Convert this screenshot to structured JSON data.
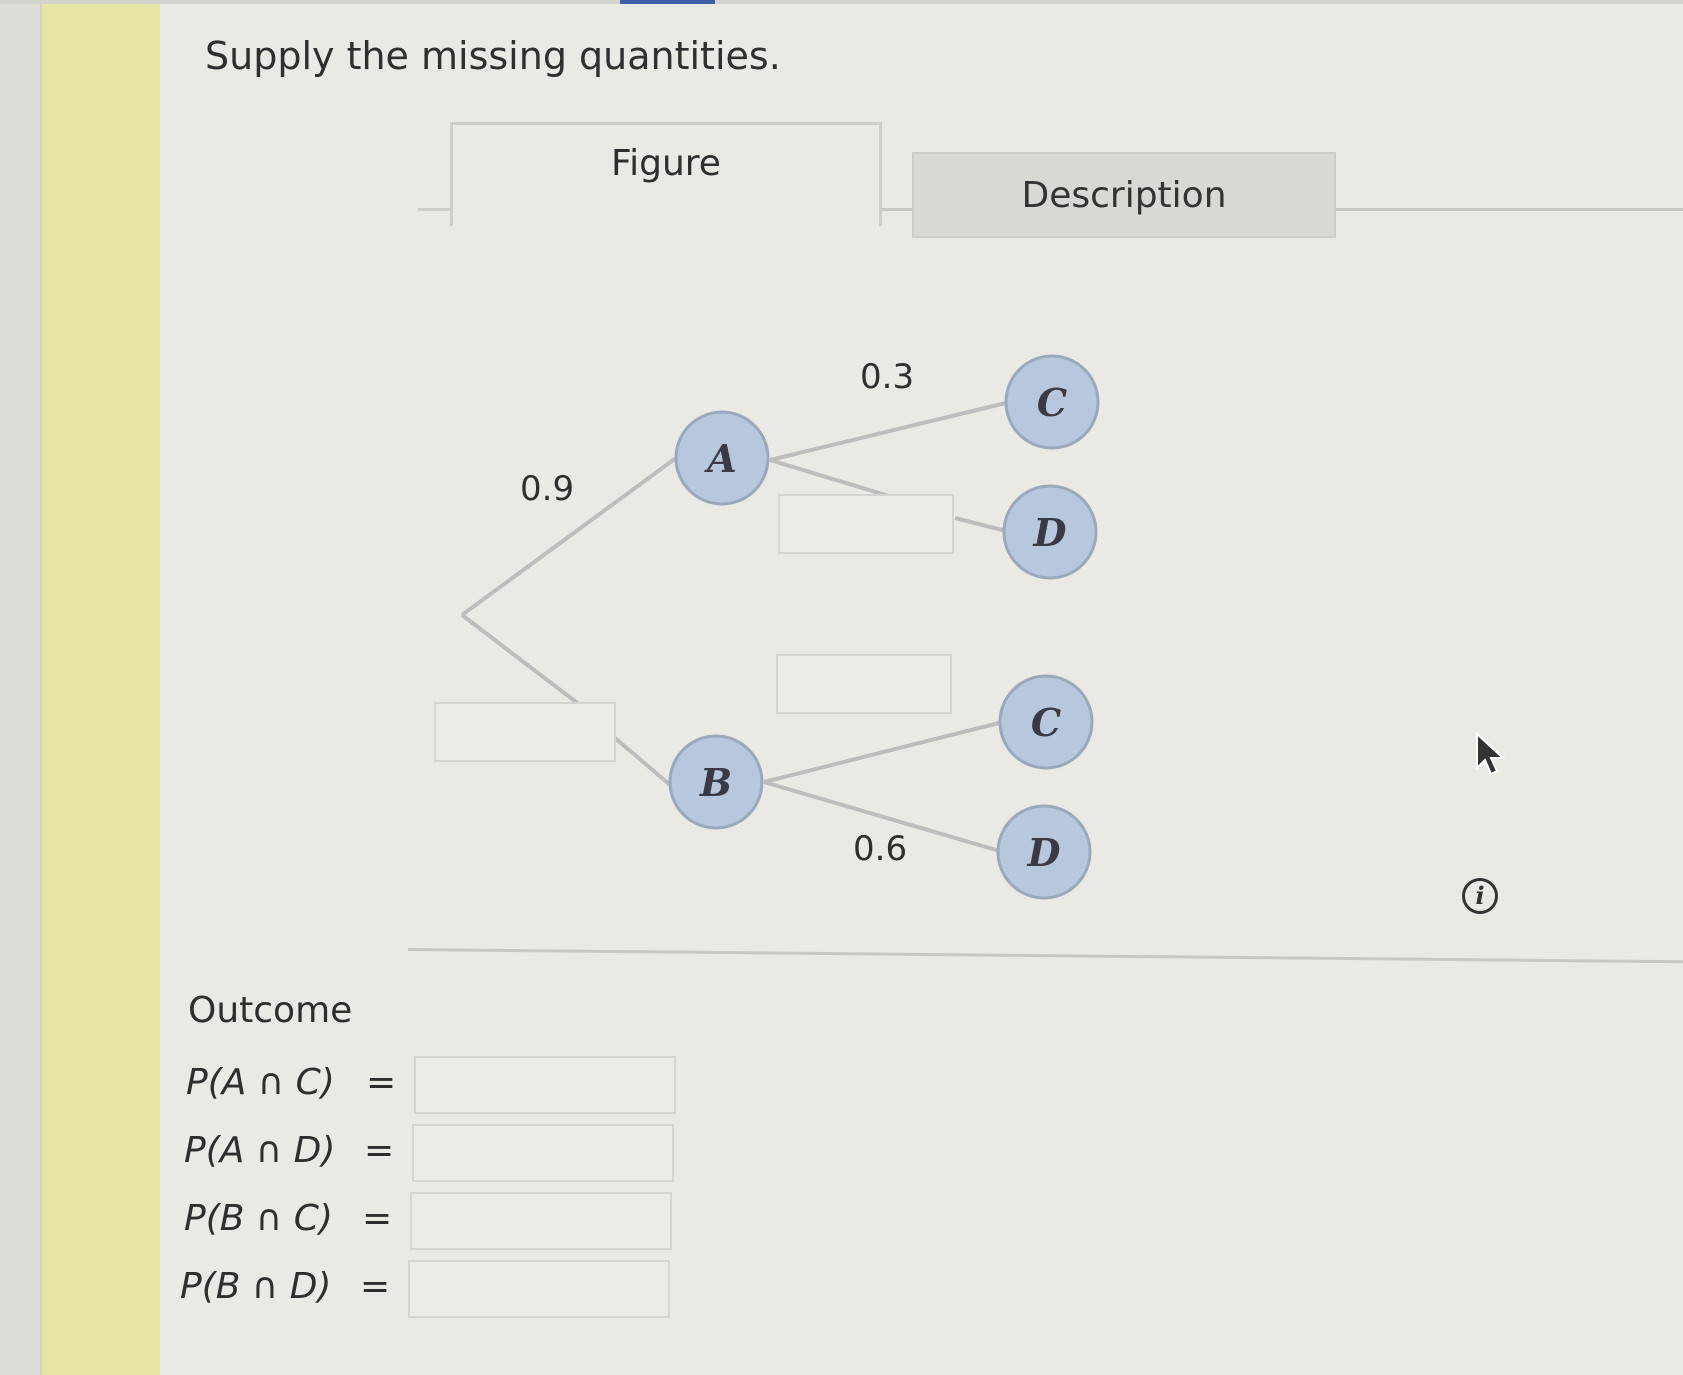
{
  "instructions": "Supply the missing quantities.",
  "tabs": {
    "figure": "Figure",
    "description": "Description"
  },
  "tree": {
    "nodes": {
      "A": "A",
      "B": "B",
      "AC": "C",
      "AD": "D",
      "BC": "C",
      "BD": "D"
    },
    "probabilities": {
      "root_to_A": "0.9",
      "root_to_B": "",
      "A_to_C": "0.3",
      "A_to_D": "",
      "B_to_C": "",
      "B_to_D": "0.6"
    },
    "node_color": "#b7c8de"
  },
  "info_icon": "i",
  "outcomes": {
    "title": "Outcome",
    "rows": [
      {
        "label": "P(A ∩ C)",
        "equals": "=",
        "value": ""
      },
      {
        "label": "P(A ∩ D)",
        "equals": "=",
        "value": ""
      },
      {
        "label": "P(B ∩ C)",
        "equals": "=",
        "value": ""
      },
      {
        "label": "P(B ∩ D)",
        "equals": "=",
        "value": ""
      }
    ]
  }
}
